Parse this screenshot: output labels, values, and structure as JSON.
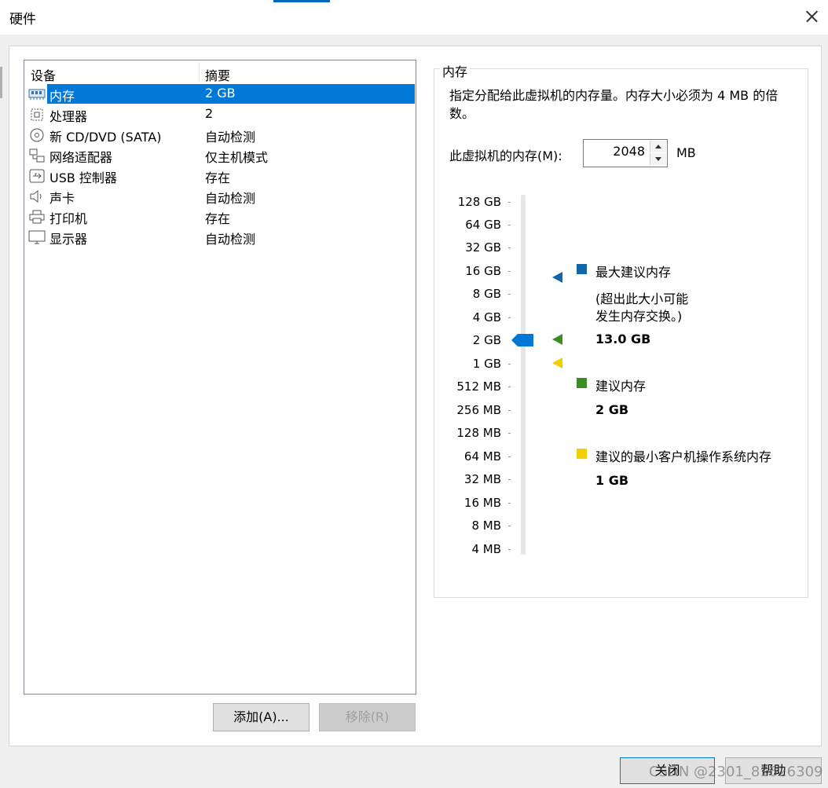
{
  "window": {
    "title": "硬件"
  },
  "device_list": {
    "columns": [
      "设备",
      "摘要"
    ],
    "rows": [
      {
        "name": "内存",
        "summary": "2 GB",
        "icon": "memory-icon"
      },
      {
        "name": "处理器",
        "summary": "2",
        "icon": "cpu-icon"
      },
      {
        "name": "新 CD/DVD (SATA)",
        "summary": "自动检测",
        "icon": "cd-dvd-icon"
      },
      {
        "name": "网络适配器",
        "summary": "仅主机模式",
        "icon": "network-icon"
      },
      {
        "name": "USB 控制器",
        "summary": "存在",
        "icon": "usb-icon"
      },
      {
        "name": "声卡",
        "summary": "自动检测",
        "icon": "speaker-icon"
      },
      {
        "name": "打印机",
        "summary": "存在",
        "icon": "printer-icon"
      },
      {
        "name": "显示器",
        "summary": "自动检测",
        "icon": "monitor-icon"
      }
    ]
  },
  "buttons": {
    "add": "添加(A)...",
    "remove": "移除(R)",
    "close": "关闭",
    "help": "帮助"
  },
  "memory": {
    "group_title": "内存",
    "description": "指定分配给此虚拟机的内存量。内存大小必须为 4 MB 的倍数。",
    "field_label": "此虚拟机的内存(M):",
    "value": "2048",
    "unit": "MB",
    "scale": [
      "128 GB",
      "64 GB",
      "32 GB",
      "16 GB",
      "8 GB",
      "4 GB",
      "2 GB",
      "1 GB",
      "512 MB",
      "256 MB",
      "128 MB",
      "64 MB",
      "32 MB",
      "16 MB",
      "8 MB",
      "4 MB"
    ],
    "legend": {
      "max": {
        "title": "最大建议内存",
        "note1": "(超出此大小可能",
        "note2": "发生内存交换。)",
        "value": "13.0 GB",
        "color": "#1464a8"
      },
      "recommended": {
        "title": "建议内存",
        "value": "2 GB",
        "color": "#3c8c22"
      },
      "min": {
        "title": "建议的最小客户机操作系统内存",
        "value": "1 GB",
        "color": "#f0d000"
      }
    },
    "thumb_color": "#0078d7"
  },
  "watermark": "CSDN @2301_81626309"
}
